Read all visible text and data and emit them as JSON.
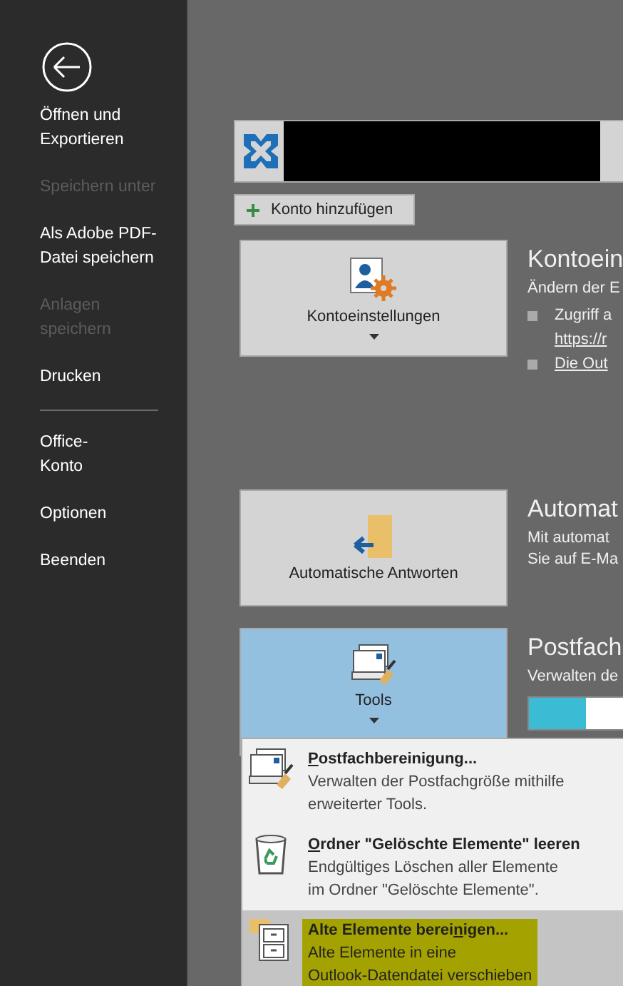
{
  "sidebar": {
    "items": [
      {
        "label_lines": [
          "Öffnen und",
          "Exportieren"
        ],
        "disabled": false
      },
      {
        "label_lines": [
          "Speichern unter"
        ],
        "disabled": true
      },
      {
        "label_lines": [
          "Als Adobe PDF-",
          "Datei speichern"
        ],
        "disabled": false
      },
      {
        "label_lines": [
          "Anlagen",
          "speichern"
        ],
        "disabled": true
      },
      {
        "label_lines": [
          "Drucken"
        ],
        "disabled": false
      },
      {
        "kind": "divider"
      },
      {
        "label_lines": [
          "Office-",
          "Konto"
        ],
        "disabled": false
      },
      {
        "label_lines": [
          "Optionen"
        ],
        "disabled": false
      },
      {
        "label_lines": [
          "Beenden"
        ],
        "disabled": false
      }
    ]
  },
  "add_account": {
    "label": "Konto hinzufügen"
  },
  "sections": [
    {
      "kind": "settings",
      "tile_label": "Kontoeinstellungen",
      "dropdown": true,
      "selected": false,
      "heading": "Kontoein",
      "lines": [
        {
          "kind": "text",
          "text": "Ändern der E"
        },
        {
          "kind": "bullet",
          "text": "Zugriff a"
        },
        {
          "kind": "link",
          "text": "https://r"
        },
        {
          "kind": "bullet-link",
          "text": "Die Out"
        }
      ]
    },
    {
      "kind": "auto-reply",
      "tile_label": "Automatische Antworten",
      "dropdown": false,
      "selected": false,
      "heading": "Automat",
      "lines": [
        {
          "kind": "text",
          "text": "Mit automat"
        },
        {
          "kind": "text",
          "text": "Sie auf E-Ma"
        }
      ]
    },
    {
      "kind": "tools",
      "tile_label": "Tools",
      "dropdown": true,
      "selected": true,
      "heading": "Postfach",
      "lines": [
        {
          "kind": "text",
          "text": "Verwalten de"
        },
        {
          "kind": "bar",
          "level": 0.5
        }
      ]
    }
  ],
  "menu": {
    "items": [
      {
        "kind": "cleanup",
        "title_parts": [
          {
            "text": "P",
            "access_key": true
          },
          {
            "text": "ostfachbereinigung...",
            "access_key": false
          }
        ],
        "description": [
          "Verwalten der Postfachgröße mithilfe",
          "erweiterter Tools."
        ],
        "selected": false,
        "highlighted": false
      },
      {
        "kind": "empty-bin",
        "title_parts": [
          {
            "text": "O",
            "access_key": true
          },
          {
            "text": "rdner \"Gelöschte Elemente\" leeren",
            "access_key": false
          }
        ],
        "description": [
          "Endgültiges Löschen aller Elemente",
          "im Ordner \"Gelöschte Elemente\"."
        ],
        "selected": false,
        "highlighted": false
      },
      {
        "kind": "archive",
        "title_parts": [
          {
            "text": "Alte Elemente berei",
            "access_key": false
          },
          {
            "text": "n",
            "access_key": true
          },
          {
            "text": "igen...",
            "access_key": false
          }
        ],
        "description": [
          "Alte Elemente in eine",
          "Outlook-Datendatei verschieben"
        ],
        "selected": true,
        "highlighted": true
      }
    ]
  }
}
